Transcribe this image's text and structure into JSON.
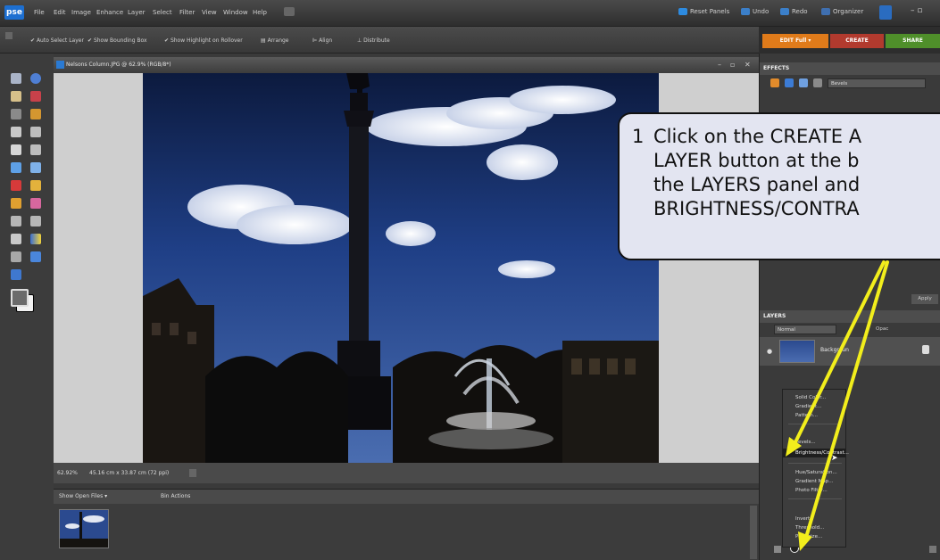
{
  "menubar": {
    "logo": "pse",
    "items": [
      "File",
      "Edit",
      "Image",
      "Enhance",
      "Layer",
      "Select",
      "Filter",
      "View",
      "Window",
      "Help"
    ],
    "reset_panels": "Reset Panels",
    "undo": "Undo",
    "redo": "Redo",
    "organizer": "Organizer"
  },
  "options_bar": {
    "auto_select_layer": "Auto Select Layer",
    "show_bounding_box": "Show Bounding Box",
    "show_highlight": "Show Highlight on Rollover",
    "arrange": "Arrange",
    "align": "Align",
    "distribute": "Distribute"
  },
  "mode_tabs": {
    "edit_full": "EDIT Full",
    "create": "CREATE",
    "share": "SHARE"
  },
  "document": {
    "title": "Nelsons Column.JPG @ 62.9% (RGB/8*)",
    "zoom": "62.92%",
    "size": "45.16 cm x 33.87 cm (72 ppi)"
  },
  "project_bin": {
    "dropdown": "Show Open Files",
    "actions": "Bin Actions"
  },
  "effects_panel": {
    "title": "EFFECTS",
    "dropdown": "Bevels",
    "apply": "Apply"
  },
  "layers_panel": {
    "title": "LAYERS",
    "blend_mode": "Normal",
    "opacity": "Opac",
    "layer_name": "Backgroun"
  },
  "adjustment_menu": {
    "items": [
      {
        "label": "Solid Color...",
        "highlighted": false
      },
      {
        "label": "Gradient...",
        "highlighted": false
      },
      {
        "label": "Pattern...",
        "highlighted": false
      },
      {
        "label": "Levels...",
        "highlighted": false
      },
      {
        "label": "Brightness/Contrast...",
        "highlighted": true
      },
      {
        "label": "Hue/Saturation...",
        "highlighted": false
      },
      {
        "label": "Gradient Map...",
        "highlighted": false
      },
      {
        "label": "Photo Filter...",
        "highlighted": false
      },
      {
        "label": "Invert",
        "highlighted": false
      },
      {
        "label": "Threshold...",
        "highlighted": false
      },
      {
        "label": "Posterize...",
        "highlighted": false
      }
    ]
  },
  "callout": {
    "number": "1",
    "lines": [
      "Click on the CREATE A",
      "LAYER button at the b",
      "the LAYERS panel and",
      "BRIGHTNESS/CONTRA"
    ]
  },
  "colors": {
    "arrow": "#f2ee1c",
    "callout_fill": "#e3e5f1",
    "create_tab": "#b23a2e",
    "share_tab": "#4f8f2a",
    "edit_tab": "#e07b1a"
  }
}
